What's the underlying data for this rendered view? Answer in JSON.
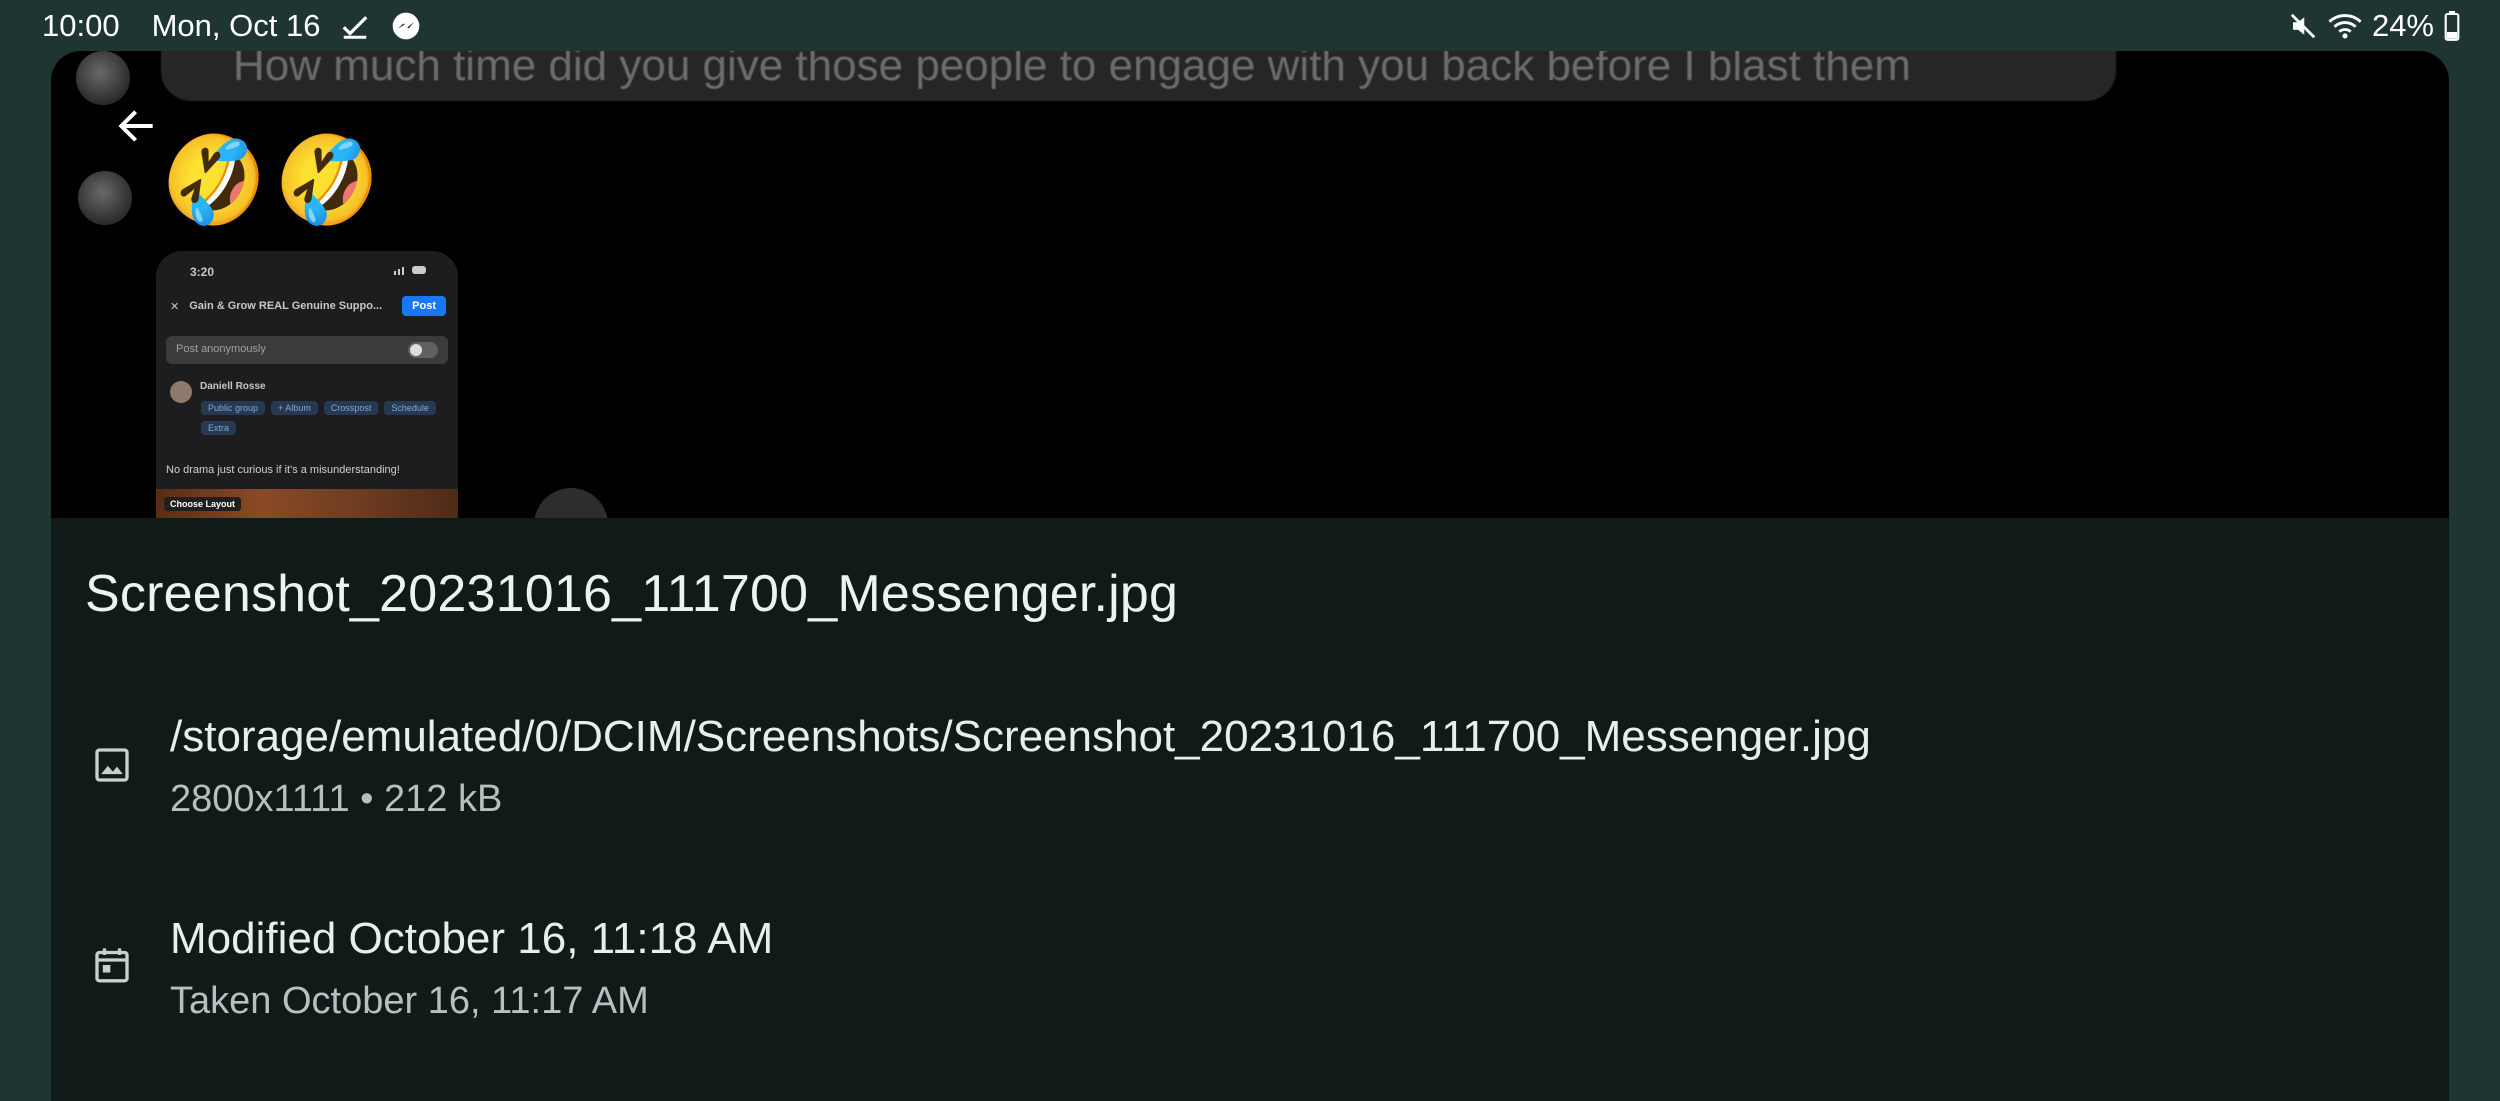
{
  "status_bar": {
    "time": "10:00",
    "date": "Mon, Oct 16",
    "battery": "24%",
    "icons": [
      "check-icon",
      "messenger-icon",
      "mute-icon",
      "wifi-icon",
      "battery-icon"
    ]
  },
  "preview": {
    "message_text": "How much time did you give those people to engage with you back before I blast them",
    "emojis": [
      "🤣",
      "🤣"
    ],
    "phone": {
      "time": "3:20",
      "group_title": "Gain & Grow REAL Genuine Suppo...",
      "post_label": "Post",
      "anon_label": "Post anonymously",
      "user_name": "Daniell Rosse",
      "chips": [
        "Public group",
        "+ Album",
        "Crosspost",
        "Schedule",
        "Extra"
      ],
      "body_text": "No drama just curious if it's a misunderstanding!",
      "layout_label": "Choose Layout"
    }
  },
  "details": {
    "file_name": "Screenshot_20231016_111700_Messenger.jpg",
    "path": "/storage/emulated/0/DCIM/Screenshots/Screenshot_20231016_111700_Messenger.jpg",
    "size_info": "2800x1111  •  212 kB",
    "modified": "Modified October 16, 11:18 AM",
    "taken": "Taken October 16, 11:17 AM"
  },
  "colors": {
    "background": "#1f3531",
    "panel": "#0f1a19",
    "text_primary": "#e9eeed",
    "text_secondary": "#b7c0be"
  }
}
